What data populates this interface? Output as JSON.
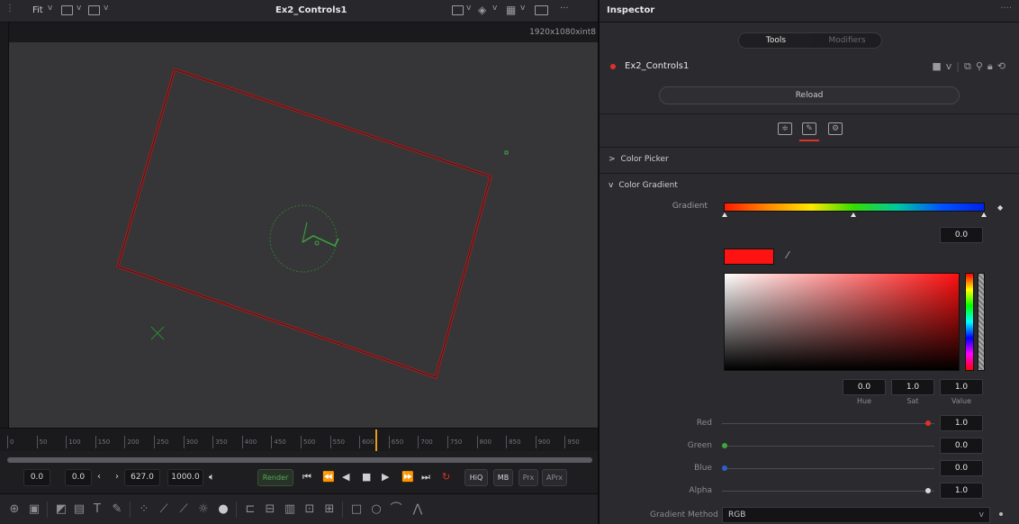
{
  "viewer": {
    "fit_label": "Fit",
    "title": "Ex2_Controls1",
    "resolution": "1920x1080xint8",
    "more": "···"
  },
  "timeline": {
    "ticks": [
      "0",
      "50",
      "100",
      "150",
      "200",
      "250",
      "300",
      "350",
      "400",
      "450",
      "500",
      "550",
      "600",
      "650",
      "700",
      "750",
      "800",
      "850",
      "900",
      "950"
    ],
    "playhead_frame": 627
  },
  "transport": {
    "start": "0.0",
    "range_start": "0.0",
    "current": "627.0",
    "end": "1000.0",
    "render_label": "Render",
    "hiq": "HiQ",
    "mb": "MB",
    "prx": "Prx",
    "aprx": "APrx"
  },
  "inspector": {
    "title": "Inspector",
    "more": "····",
    "tabs": {
      "tools": "Tools",
      "modifiers": "Modifiers"
    },
    "tool_name": "Ex2_Controls1",
    "reload_label": "Reload",
    "sections": {
      "color_picker": "Color Picker",
      "color_gradient": "Color Gradient"
    },
    "gradient": {
      "label": "Gradient",
      "position_value": "0.0"
    },
    "hsv": {
      "hue": "0.0",
      "sat": "1.0",
      "value": "1.0",
      "hue_label": "Hue",
      "sat_label": "Sat",
      "value_label": "Value"
    },
    "channels": {
      "red_label": "Red",
      "red_value": "1.0",
      "green_label": "Green",
      "green_value": "0.0",
      "blue_label": "Blue",
      "blue_value": "0.0",
      "alpha_label": "Alpha",
      "alpha_value": "1.0"
    },
    "gradient_method": {
      "label": "Gradient Method",
      "value": "RGB"
    }
  },
  "colors": {
    "accent_red": "#e0302a",
    "playhead": "#e89a1d",
    "overlay_green": "#3aa83a"
  }
}
